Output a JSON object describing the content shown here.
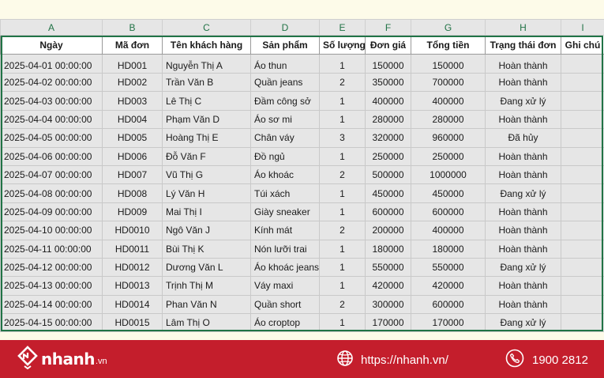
{
  "sheet": {
    "column_letters": [
      "A",
      "B",
      "C",
      "D",
      "E",
      "F",
      "G",
      "H",
      "I"
    ],
    "headers": [
      "Ngày",
      "Mã đơn",
      "Tên khách hàng",
      "Sản phẩm",
      "Số lượng",
      "Đơn giá",
      "Tổng tiền",
      "Trạng thái đơn",
      "Ghi chú"
    ],
    "rows": [
      [
        "2025-04-01 00:00:00",
        "HD001",
        "Nguyễn Thị A",
        "Áo thun",
        "1",
        "150000",
        "150000",
        "Hoàn thành",
        ""
      ],
      [
        "2025-04-02 00:00:00",
        "HD002",
        "Trần Văn B",
        "Quần jeans",
        "2",
        "350000",
        "700000",
        "Hoàn thành",
        ""
      ],
      [
        "2025-04-03 00:00:00",
        "HD003",
        "Lê Thị C",
        "Đầm công sở",
        "1",
        "400000",
        "400000",
        "Đang xử lý",
        ""
      ],
      [
        "2025-04-04 00:00:00",
        "HD004",
        "Phạm Văn D",
        "Áo sơ mi",
        "1",
        "280000",
        "280000",
        "Hoàn thành",
        ""
      ],
      [
        "2025-04-05 00:00:00",
        "HD005",
        "Hoàng Thị E",
        "Chân váy",
        "3",
        "320000",
        "960000",
        "Đã hủy",
        ""
      ],
      [
        "2025-04-06 00:00:00",
        "HD006",
        "Đỗ Văn F",
        "Đồ ngủ",
        "1",
        "250000",
        "250000",
        "Hoàn thành",
        ""
      ],
      [
        "2025-04-07 00:00:00",
        "HD007",
        "Vũ Thị G",
        "Áo khoác",
        "2",
        "500000",
        "1000000",
        "Hoàn thành",
        ""
      ],
      [
        "2025-04-08 00:00:00",
        "HD008",
        "Lý Văn H",
        "Túi xách",
        "1",
        "450000",
        "450000",
        "Đang xử lý",
        ""
      ],
      [
        "2025-04-09 00:00:00",
        "HD009",
        "Mai Thị I",
        "Giày sneaker",
        "1",
        "600000",
        "600000",
        "Hoàn thành",
        ""
      ],
      [
        "2025-04-10 00:00:00",
        "HD0010",
        "Ngô Văn J",
        "Kính mát",
        "2",
        "200000",
        "400000",
        "Hoàn thành",
        ""
      ],
      [
        "2025-04-11 00:00:00",
        "HD0011",
        "Bùi Thị K",
        "Nón lưỡi trai",
        "1",
        "180000",
        "180000",
        "Hoàn thành",
        ""
      ],
      [
        "2025-04-12 00:00:00",
        "HD0012",
        "Dương Văn L",
        "Áo khoác jeans",
        "1",
        "550000",
        "550000",
        "Đang xử lý",
        ""
      ],
      [
        "2025-04-13 00:00:00",
        "HD0013",
        "Trịnh Thị M",
        "Váy maxi",
        "1",
        "420000",
        "420000",
        "Hoàn thành",
        ""
      ],
      [
        "2025-04-14 00:00:00",
        "HD0014",
        "Phan Văn N",
        "Quần short",
        "2",
        "300000",
        "600000",
        "Hoàn thành",
        ""
      ],
      [
        "2025-04-15 00:00:00",
        "HD0015",
        "Lâm Thị O",
        "Áo croptop",
        "1",
        "170000",
        "170000",
        "Đang xử lý",
        ""
      ]
    ]
  },
  "footer": {
    "brand_name": "nhanh",
    "brand_tld": ".vn",
    "website": "https://nhanh.vn/",
    "phone": "1900 2812",
    "brand_icon": "nhanh-logo-icon",
    "web_icon": "globe-icon",
    "phone_icon": "phone-icon"
  },
  "colors": {
    "accent_green": "#217346",
    "footer_red": "#c41e2c",
    "background": "#fdfbe9"
  }
}
